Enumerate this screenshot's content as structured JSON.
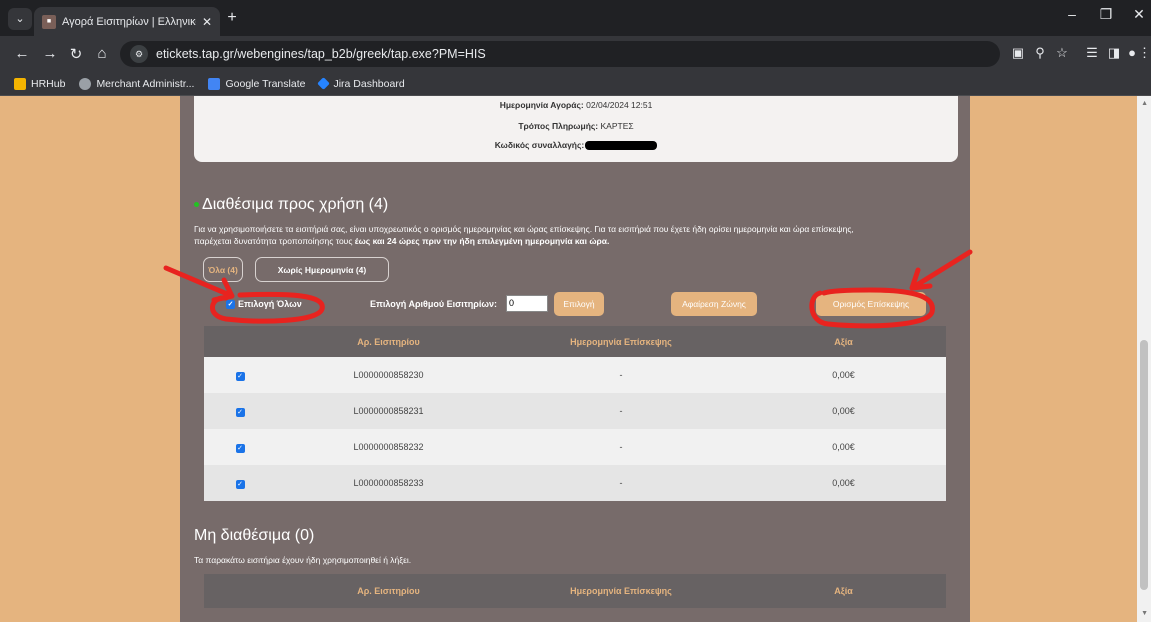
{
  "browser": {
    "tab_title": "Αγορά Εισιτηρίων | Ελληνικοί",
    "new_tab": "+",
    "url": "etickets.tap.gr/webengines/tap_b2b/greek/tap.exe?PM=HIS",
    "bookmarks": [
      {
        "label": "HRHub",
        "color": "#f4b400"
      },
      {
        "label": "Merchant Administr...",
        "color": "#9aa0a6"
      },
      {
        "label": "Google Translate",
        "color": "#4285f4"
      },
      {
        "label": "Jira Dashboard",
        "color": "#2684ff"
      }
    ]
  },
  "purchase": {
    "date_label": "Ημερομηνία Αγοράς:",
    "date_value": "02/04/2024 12:51",
    "payment_label": "Τρόπος Πληρωμής:",
    "payment_value": "ΚΑΡΤΕΣ",
    "transaction_label": "Κωδικός συναλλαγής:"
  },
  "available": {
    "title": "Διαθέσιμα προς χρήση (4)",
    "desc_line1": "Για να χρησιμοποιήσετε τα εισιτήριά σας, είναι υποχρεωτικός ο ορισμός ημερομηνίας και ώρας επίσκεψης. Για τα εισιτήριά που έχετε ήδη ορίσει ημερομηνία και ώρα επίσκεψης,",
    "desc_line2_plain": "παρέχεται δυνατότητα τροποποίησης τους ",
    "desc_line2_bold": "έως και 24 ώρες πριν την ήδη επιλεγμένη ημερομηνία και ώρα.",
    "filter_all": "Όλα (4)",
    "filter_nodate": "Χωρίς Ημερομηνία (4)",
    "select_all": "Επιλογή Όλων",
    "count_label": "Επιλογή Αριθμού Εισιτηρίων:",
    "count_value": "0",
    "select_button": "Επιλογή",
    "remove_zone_button": "Αφαίρεση Ζώνης",
    "set_visit_button": "Ορισμός Επίσκεψης",
    "columns": [
      "Αρ. Εισιτηρίου",
      "Ημερομηνία Επίσκεψης",
      "Αξία"
    ],
    "rows": [
      {
        "ticket": "L0000000858230",
        "visit": "-",
        "value": "0,00€"
      },
      {
        "ticket": "L0000000858231",
        "visit": "-",
        "value": "0,00€"
      },
      {
        "ticket": "L0000000858232",
        "visit": "-",
        "value": "0,00€"
      },
      {
        "ticket": "L0000000858233",
        "visit": "-",
        "value": "0,00€"
      }
    ]
  },
  "unavailable": {
    "title": "Μη διαθέσιμα (0)",
    "desc": "Τα παρακάτω εισιτήρια έχουν ήδη χρησιμοποιηθεί ή λήξει.",
    "columns": [
      "Αρ. Εισιτηρίου",
      "Ημερομηνία Επίσκεψης",
      "Αξία"
    ]
  },
  "colors": {
    "accent": "#e5b47f",
    "panel": "#776b6a",
    "annotation": "#e8231f"
  }
}
